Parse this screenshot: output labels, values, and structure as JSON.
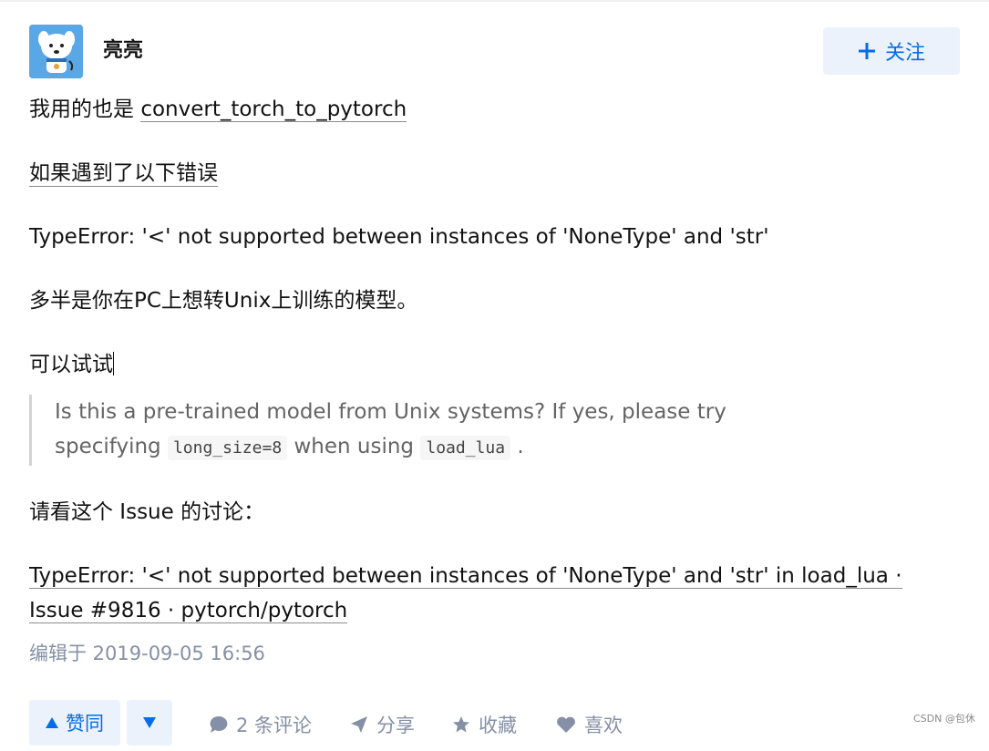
{
  "author": {
    "name": "亮亮",
    "follow_label": "关注",
    "avatar_icon": "dog-avatar-icon"
  },
  "content": {
    "para1_prefix": "我用的也是 ",
    "para1_link": "convert_torch_to_pytorch",
    "para2": "如果遇到了以下错误",
    "para3": "TypeError: '<' not supported between instances of 'NoneType' and 'str'",
    "para4": "多半是你在PC上想转Unix上训练的模型。",
    "para5": "可以试试",
    "quote": {
      "line1": "Is this a pre-trained model from Unix systems? If yes, please try",
      "line2_prefix": "specifying ",
      "code1": "long_size=8",
      "line2_middle": " when using ",
      "code2": "load_lua",
      "line2_suffix": " ."
    },
    "para6": "请看这个 Issue 的讨论：",
    "issue_link": "TypeError: '<' not supported between instances of 'NoneType' and 'str' in load_lua · Issue #9816 · pytorch/pytorch",
    "edit_time": "编辑于 2019-09-05 16:56"
  },
  "actions": {
    "upvote_label": "赞同",
    "comments_label": "2 条评论",
    "share_label": "分享",
    "favorite_label": "收藏",
    "like_label": "喜欢"
  },
  "watermark": "CSDN @包休",
  "colors": {
    "accent": "#056de8",
    "accent_bg": "#ebf2fc",
    "muted": "#8590a6",
    "text": "#121212"
  }
}
